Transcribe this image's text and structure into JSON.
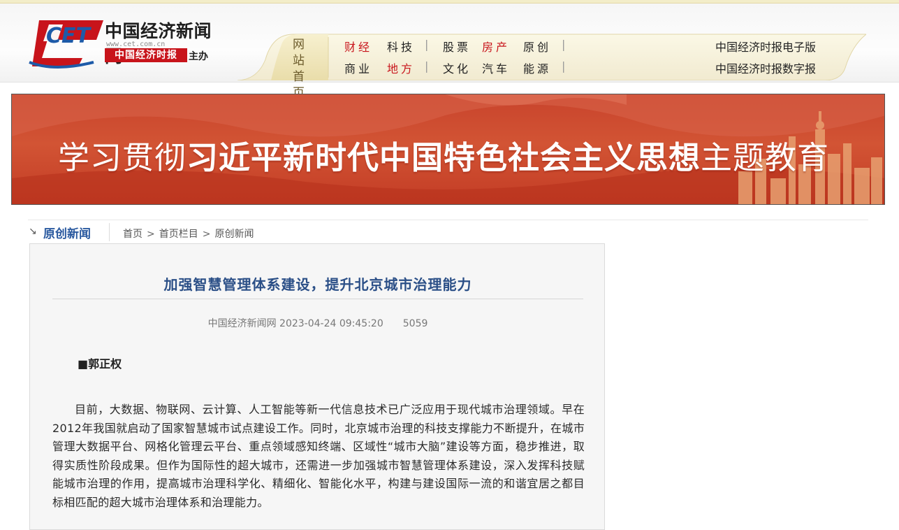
{
  "site": {
    "logo_mark": "CET",
    "logo_name": "中国经济新闻网",
    "logo_url": "www.cet.com.cn",
    "logo_paper": "中国经济时报",
    "logo_host": "主办"
  },
  "nav": {
    "home_line1": "网站",
    "home_line2": "首页",
    "row1": [
      "财经",
      "科技",
      "股票",
      "房产",
      "原创"
    ],
    "row2": [
      "商业",
      "地方",
      "文化",
      "汽车",
      "能源"
    ],
    "separator": "|",
    "epaper": "中国经济时报电子版",
    "digital": "中国经济时报数字报"
  },
  "banner": {
    "text_light1": "学习贯彻",
    "text_bold": "习近平新时代中国特色社会主义思想",
    "text_light2": "主题教育"
  },
  "section": {
    "title": "原创新闻",
    "crumbs": [
      "首页",
      "首页栏目",
      "原创新闻"
    ],
    "crumb_sep": ">"
  },
  "article": {
    "title": "加强智慧管理体系建设，提升北京城市治理能力",
    "source": "中国经济新闻网",
    "datetime": "2023-04-24 09:45:20",
    "views": "5059",
    "author": "■郭正权",
    "paragraph": "目前，大数据、物联网、云计算、人工智能等新一代信息技术已广泛应用于现代城市治理领域。早在2012年我国就启动了国家智慧城市试点建设工作。同时，北京城市治理的科技支撑能力不断提升，在城市管理大数据平台、网格化管理云平台、重点领域感知终端、区域性“城市大脑”建设等方面，稳步推进，取得实质性阶段成果。但作为国际性的超大城市，还需进一步加强城市智慧管理体系建设，深入发挥科技赋能城市治理的作用，提高城市治理科学化、精细化、智能化水平，构建与建设国际一流的和谐宜居之都目标相匹配的超大城市治理体系和治理能力。"
  },
  "colors": {
    "brand_red": "#c8141b",
    "title_blue": "#2b4f87",
    "banner_red": "#c8432c"
  }
}
